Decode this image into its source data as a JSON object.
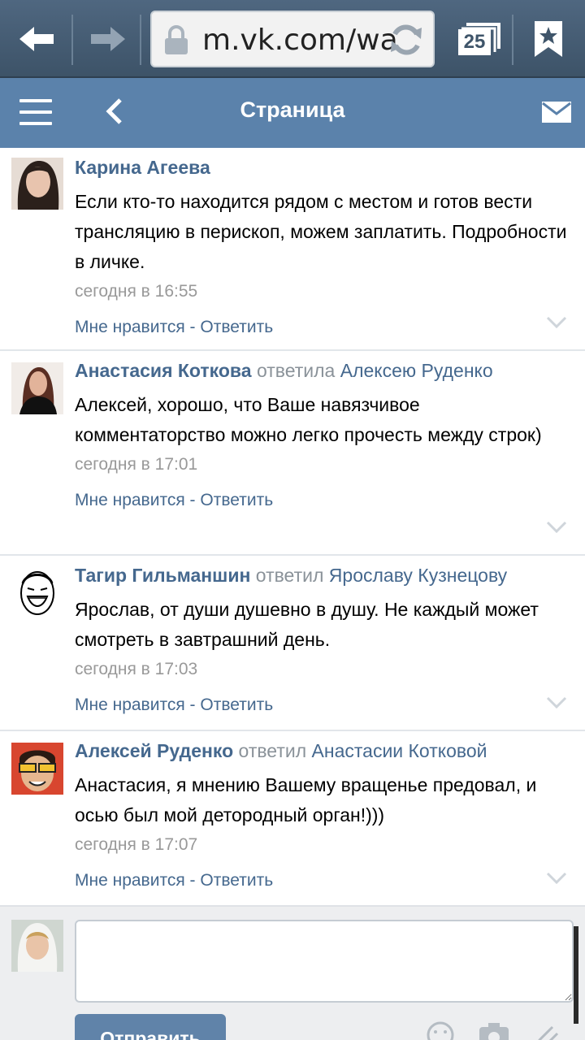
{
  "browser": {
    "url": "m.vk.com/wa",
    "tabs_count": "25"
  },
  "header": {
    "title": "Страница"
  },
  "comments": [
    {
      "author": "Карина Агеева",
      "verb": "",
      "target": "",
      "text": "Если кто-то находится рядом с местом и готов вести трансляцию в перископ, можем заплатить. Подробности в личке.",
      "time": "сегодня в 16:55",
      "like": "Мне нравится",
      "sep": " - ",
      "reply": "Ответить"
    },
    {
      "author": "Анастасия Коткова",
      "verb": "ответила",
      "target": "Алексею Руденко",
      "text": "Алексей, хорошо, что Ваше навязчивое комментаторство можно легко прочесть между строк)",
      "time": "сегодня в 17:01",
      "like": "Мне нравится",
      "sep": " - ",
      "reply": "Ответить"
    },
    {
      "author": "Тагир Гильманшин",
      "verb": "ответил",
      "target": "Ярославу Кузнецову",
      "text": "Ярослав, от души душевно в душу. Не каждый может смотреть в завтрашний день.",
      "time": "сегодня в 17:03",
      "like": "Мне нравится",
      "sep": " - ",
      "reply": "Ответить"
    },
    {
      "author": "Алексей Руденко",
      "verb": "ответил",
      "target": "Анастасии Котковой",
      "text": "Анастасия, я мнению Вашему вращенье предовал, и осью был мой детородный орган!)))",
      "time": "сегодня в 17:07",
      "like": "Мне нравится",
      "sep": " - ",
      "reply": "Ответить"
    }
  ],
  "composer": {
    "send_label": "Отправить",
    "reply_value": ""
  },
  "colors": {
    "header_bg": "#5b82ab",
    "link": "#45688e",
    "browser_bg": "#4f6780"
  }
}
